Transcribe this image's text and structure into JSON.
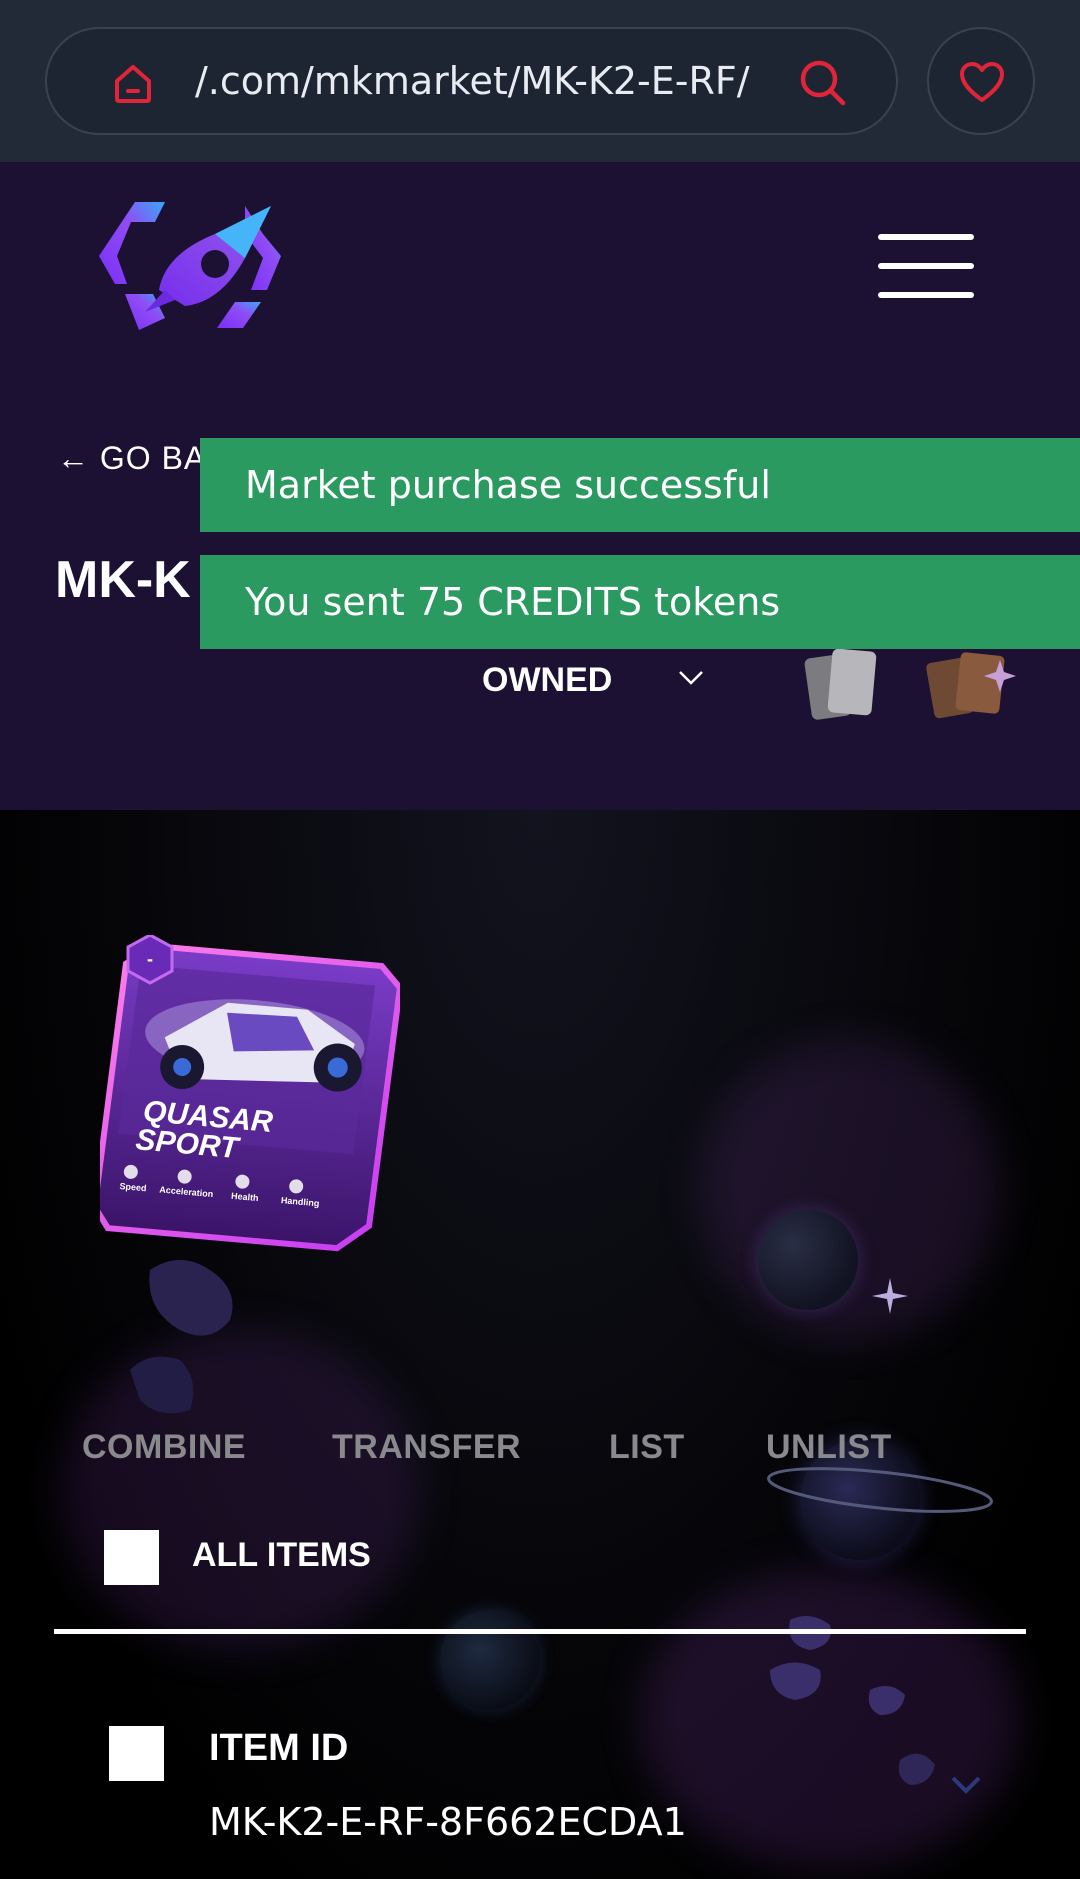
{
  "browser": {
    "url": "/.com/mkmarket/MK-K2-E-RF/",
    "home_icon": "home-icon",
    "search_icon": "search-icon",
    "favorite_icon": "heart-icon"
  },
  "header": {
    "logo_icon": "rocket-logo-icon",
    "menu_icon": "hamburger-menu-icon",
    "go_back_label": "← GO BA",
    "page_title": "MK-K",
    "filter_label": "OWNED",
    "filter_chevron": "chevron-down-icon",
    "cards_icon": "cards-icon",
    "pack_icon": "pack-icon"
  },
  "toasts": [
    {
      "message": "Market purchase successful"
    },
    {
      "message": "You sent 75 CREDITS tokens"
    }
  ],
  "card": {
    "badge": "-",
    "title_line1": "QUASAR",
    "title_line2": "SPORT",
    "stats": [
      "Speed",
      "Acceleration",
      "Health",
      "Handling"
    ]
  },
  "actions": [
    "COMBINE",
    "TRANSFER",
    "LIST",
    "UNLIST"
  ],
  "list": {
    "all_items_label": "ALL ITEMS",
    "item_id_label": "ITEM ID",
    "item_id_value": "MK-K2-E-RF-8F662ECDA1"
  },
  "colors": {
    "toast_bg": "#2a9a61",
    "header_bg": "#1c1133",
    "browser_bg": "#232a37",
    "accent_red": "#e0253a",
    "action_text": "#8a8a8e"
  }
}
